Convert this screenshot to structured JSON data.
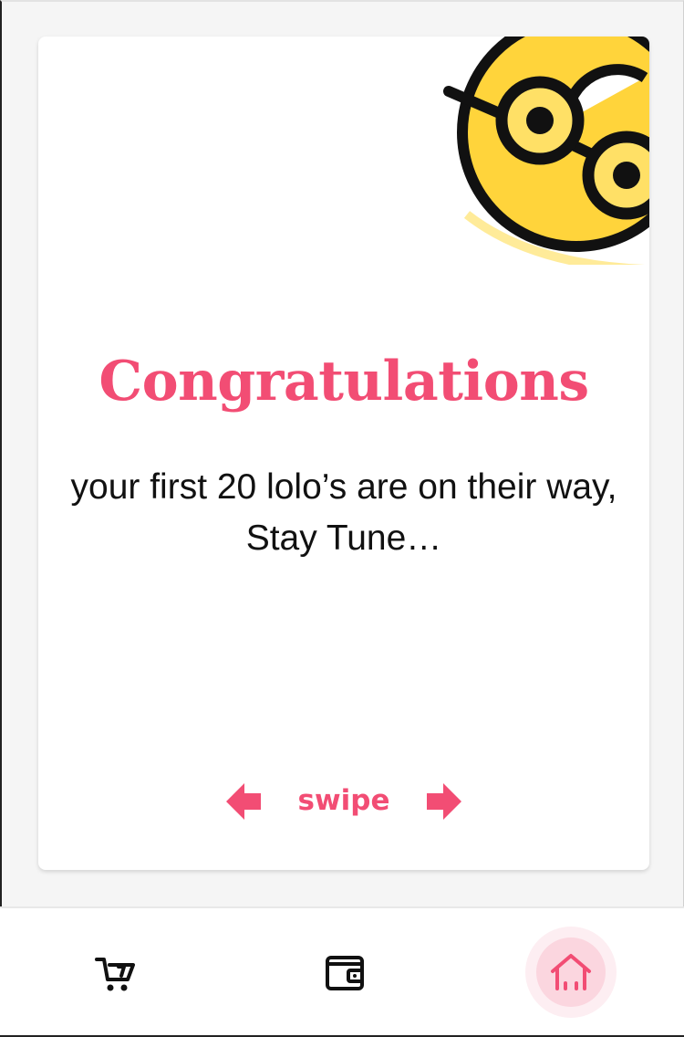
{
  "card": {
    "title": "Congratulations",
    "message": "your first 20 lolo’s are on their way, Stay Tune…",
    "swipe_label": "swipe",
    "illustration_icon": "nerd-face-emoji-icon"
  },
  "bottom_nav": {
    "items": [
      {
        "icon": "cart-icon",
        "active": false
      },
      {
        "icon": "wallet-icon",
        "active": false
      },
      {
        "icon": "home-icon",
        "active": true
      }
    ]
  },
  "colors": {
    "accent": "#f24d74",
    "text": "#111111",
    "background": "#f5f5f5",
    "card": "#ffffff",
    "emoji_yellow": "#ffd43b",
    "home_circle_outer": "#fdeef2",
    "home_circle_inner": "#fbd6df"
  }
}
